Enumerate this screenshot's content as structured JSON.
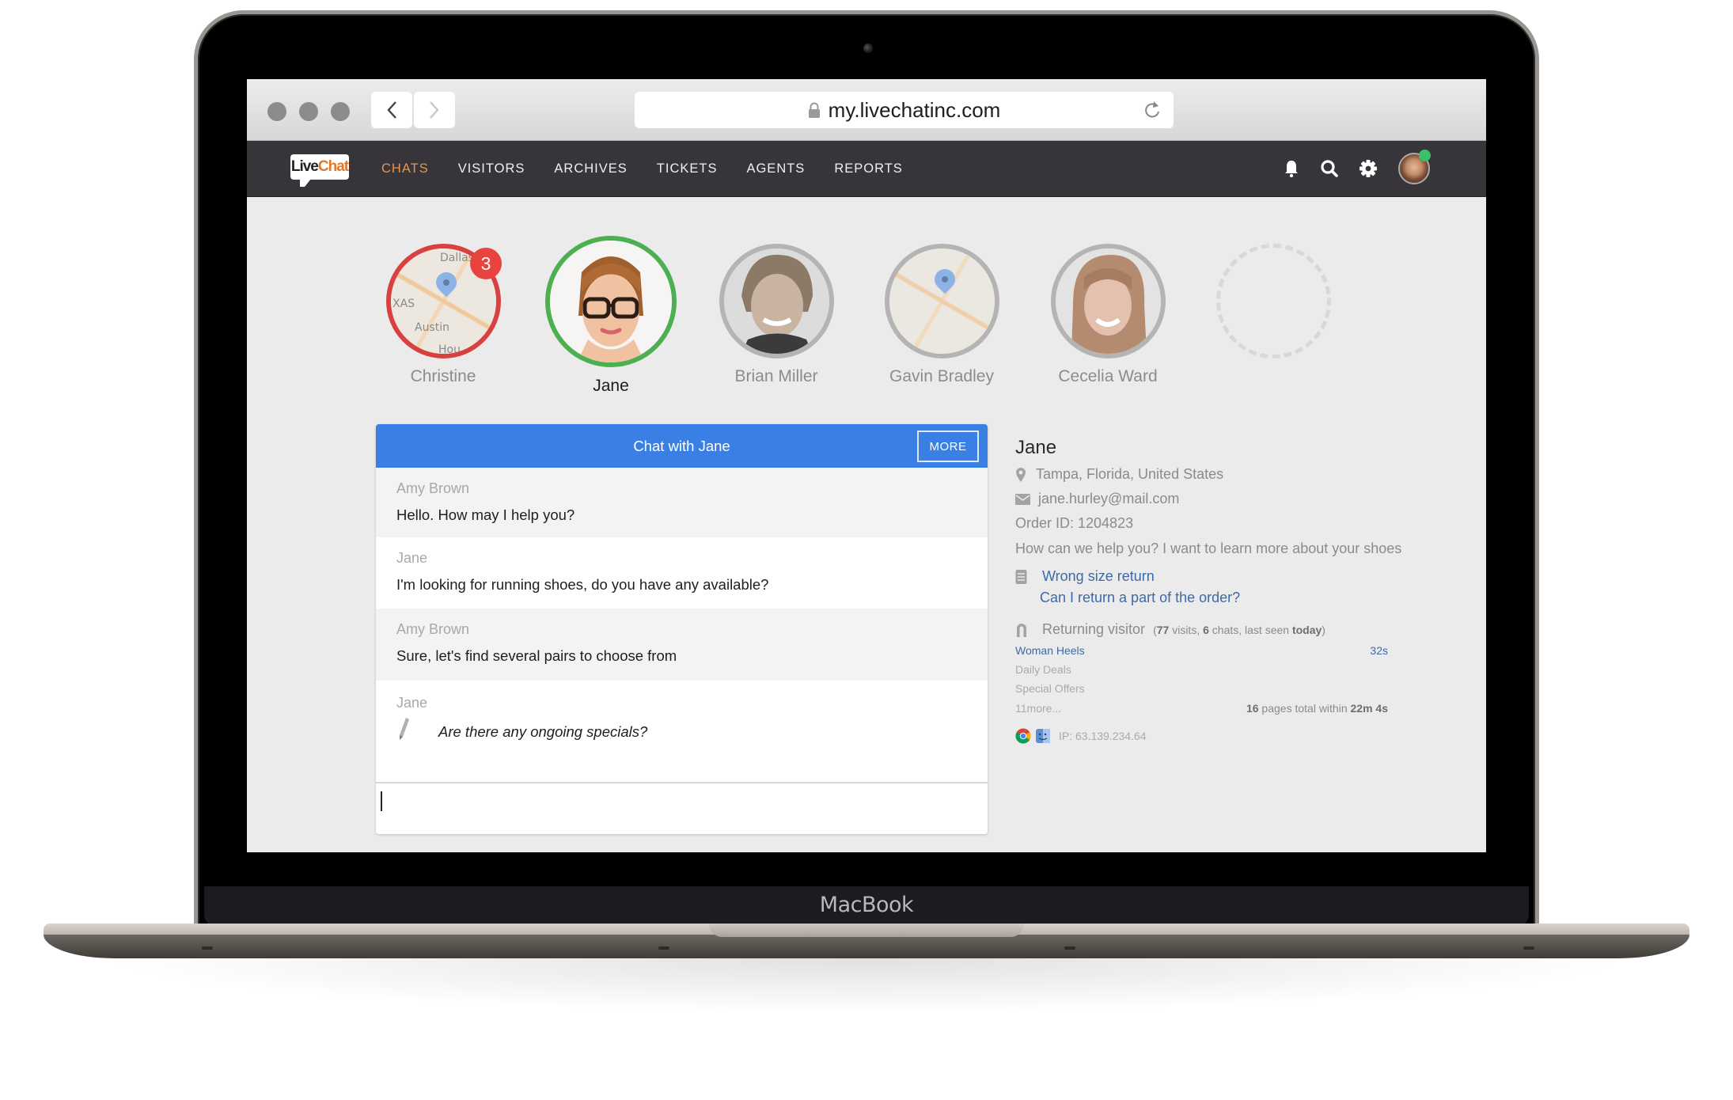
{
  "device": {
    "label": "MacBook"
  },
  "browser": {
    "url": "my.livechatinc.com",
    "icons": {
      "back": "chevron-left-icon",
      "forward": "chevron-right-icon",
      "lock": "lock-icon",
      "reload": "reload-icon"
    }
  },
  "app": {
    "logo": {
      "part1": "Live",
      "part2": "Chat"
    },
    "nav": [
      {
        "label": "CHATS",
        "active": true
      },
      {
        "label": "VISITORS",
        "active": false
      },
      {
        "label": "ARCHIVES",
        "active": false
      },
      {
        "label": "TICKETS",
        "active": false
      },
      {
        "label": "AGENTS",
        "active": false
      },
      {
        "label": "REPORTS",
        "active": false
      }
    ],
    "header_icons": [
      "bell-icon",
      "search-icon",
      "gear-icon"
    ],
    "user_status_color": "#3cbf6b",
    "accent_color": "#3a7fe4",
    "active_nav_color": "#e3964f"
  },
  "chats": [
    {
      "name": "Christine",
      "avatar": "map",
      "ring_color": "#d94040",
      "unread": "3",
      "map_labels": [
        "Dallas",
        "XAS",
        "Austin",
        "Hou"
      ]
    },
    {
      "name": "Jane",
      "avatar": "photo",
      "ring_color": "#4caf50",
      "selected": true
    },
    {
      "name": "Brian Miller",
      "avatar": "photo",
      "ring_color": "#b4b4b4"
    },
    {
      "name": "Gavin Bradley",
      "avatar": "map",
      "ring_color": "#b4b4b4"
    },
    {
      "name": "Cecelia Ward",
      "avatar": "photo",
      "ring_color": "#b4b4b4"
    }
  ],
  "chat_window": {
    "title": "Chat with Jane",
    "more_label": "MORE",
    "messages": [
      {
        "author": "Amy Brown",
        "text": "Hello. How may I help you?",
        "role": "agent"
      },
      {
        "author": "Jane",
        "text": "I'm looking for running shoes, do you have any available?",
        "role": "visitor"
      },
      {
        "author": "Amy Brown",
        "text": "Sure, let's find several pairs to choose from",
        "role": "agent"
      },
      {
        "author": "Jane",
        "text": "Are there any ongoing specials?",
        "role": "visitor",
        "typing": true
      }
    ],
    "input_value": ""
  },
  "visitor_info": {
    "name": "Jane",
    "location": "Tampa, Florida, United States",
    "email": "jane.hurley@mail.com",
    "order_id": "Order ID: 1204823",
    "question": "How can we help you? I want to learn more about your shoes",
    "tickets": [
      "Wrong size return",
      "Can I return a part of the order?"
    ],
    "returning": {
      "label": "Returning visitor",
      "open": "(",
      "visits": "77",
      "visits_label": " visits, ",
      "chats": "6",
      "chats_label": " chats, last seen ",
      "last_seen": "today",
      "close": ")"
    },
    "pages": [
      {
        "title": "Woman Heels",
        "time": "32s",
        "current": true
      },
      {
        "title": "Daily Deals"
      },
      {
        "title": "Special Offers"
      }
    ],
    "more_pages": {
      "count": "11",
      "label": " more..."
    },
    "pages_total": {
      "count": "16",
      "label": " pages total within ",
      "duration": "22m 4s"
    },
    "ip": "IP: 63.139.234.64",
    "tech_icons": [
      "chrome-icon",
      "mac-finder-icon"
    ]
  }
}
